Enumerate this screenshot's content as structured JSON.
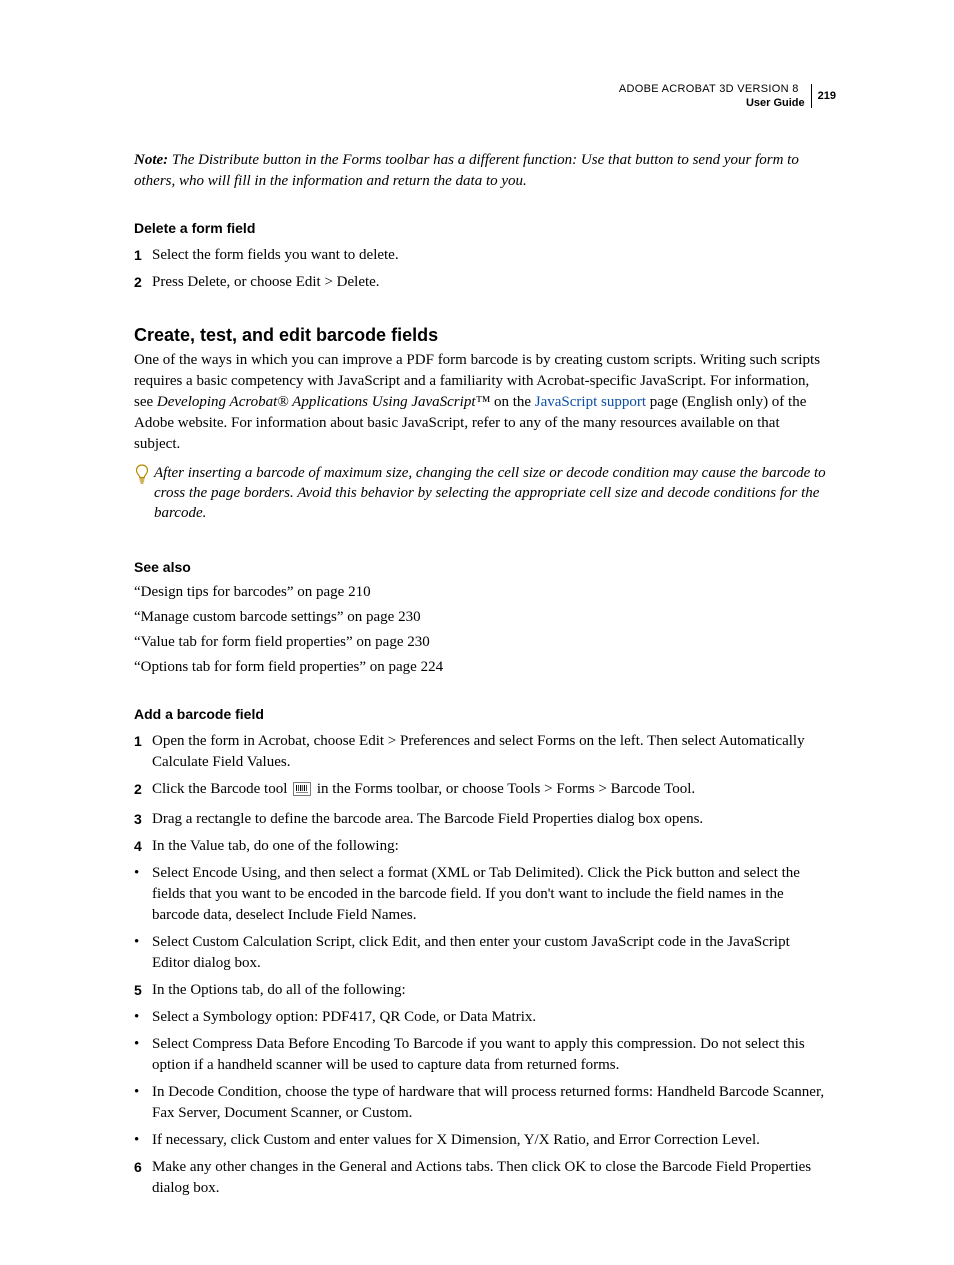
{
  "header": {
    "title": "ADOBE ACROBAT 3D VERSION 8",
    "page": "219",
    "guide": "User Guide"
  },
  "note": {
    "label": "Note:",
    "text": "The Distribute button in the Forms toolbar has a different function: Use that button to send your form to others, who will fill in the information and return the data to you."
  },
  "delete_field": {
    "heading": "Delete a form field",
    "steps": [
      "Select the form fields you want to delete.",
      "Press Delete, or choose Edit > Delete."
    ]
  },
  "barcode": {
    "heading": "Create, test, and edit barcode fields",
    "para1_pre": "One of the ways in which you can improve a PDF form barcode is by creating custom scripts. Writing such scripts requires a basic competency with JavaScript and a familiarity with Acrobat-specific JavaScript. For information, see ",
    "para1_em": "Developing Acrobat® Applications Using JavaScript™",
    "para1_mid": " on the ",
    "para1_link": "JavaScript support",
    "para1_post": " page (English only) of the Adobe website. For information about basic JavaScript, refer to any of the many resources available on that subject.",
    "tip": "After inserting a barcode of maximum size, changing the cell size or decode condition may cause the barcode to cross the page borders. Avoid this behavior by selecting the appropriate cell size and decode conditions for the barcode."
  },
  "see_also": {
    "heading": "See also",
    "items": [
      "“Design tips for barcodes” on page 210",
      "“Manage custom barcode settings” on page 230",
      "“Value tab for form field properties” on page 230",
      "“Options tab for form field properties” on page 224"
    ]
  },
  "add_barcode": {
    "heading": "Add a barcode field",
    "s1": "Open the form in Acrobat, choose Edit > Preferences and select Forms on the left. Then select Automatically Calculate Field Values.",
    "s2_pre": "Click the Barcode tool ",
    "s2_post": " in the Forms toolbar, or choose Tools > Forms > Barcode Tool.",
    "s3": "Drag a rectangle to define the barcode area. The Barcode Field Properties dialog box opens.",
    "s4": "In the Value tab, do one of the following:",
    "s4b": [
      "Select Encode Using, and then select a format (XML or Tab Delimited). Click the Pick button and select the fields that you want to be encoded in the barcode field. If you don't want to include the field names in the barcode data, deselect Include Field Names.",
      "Select Custom Calculation Script, click Edit, and then enter your custom JavaScript code in the JavaScript Editor dialog box."
    ],
    "s5": "In the Options tab, do all of the following:",
    "s5b": [
      "Select a Symbology option: PDF417, QR Code, or Data Matrix.",
      "Select Compress Data Before Encoding To Barcode if you want to apply this compression. Do not select this option if a handheld scanner will be used to capture data from returned forms.",
      "In Decode Condition, choose the type of hardware that will process returned forms: Handheld Barcode Scanner, Fax Server, Document Scanner, or Custom.",
      "If necessary, click Custom and enter values for X Dimension, Y/X Ratio, and Error Correction Level."
    ],
    "s6": "Make any other changes in the General and Actions tabs. Then click OK to close the Barcode Field Properties dialog box."
  }
}
